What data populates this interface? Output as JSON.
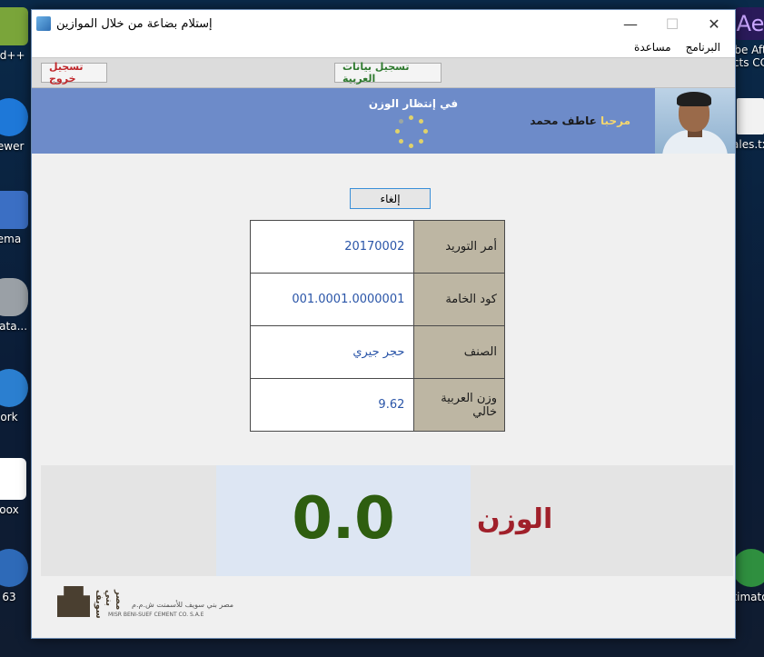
{
  "window": {
    "title": "إستلام بضاعة من خلال الموازين"
  },
  "menu": {
    "items": [
      "البرنامج",
      "مساعدة"
    ]
  },
  "toolbar": {
    "exit_label": "تسجيل خروج",
    "register_label": "تسجيل بيانات العربية"
  },
  "header": {
    "waiting_text": "في إنتظار الوزن",
    "welcome_prefix": "مرحبا",
    "user_name": "عاطف محمد"
  },
  "form": {
    "cancel_label": "إلغاء",
    "rows": [
      {
        "label": "أمر التوريد",
        "value": "20170002"
      },
      {
        "label": "كود الخامة",
        "value": "001.0001.0000001"
      },
      {
        "label": "الصنف",
        "value": "حجر جيري"
      },
      {
        "label": "وزن العربية خالي",
        "value": "9.62"
      }
    ]
  },
  "weight": {
    "value": "0.0",
    "label": "الوزن"
  },
  "footer": {
    "company_ar": "مصر بني سويف للأسمنت   ش.م.م",
    "company_en": "MISR BENI-SUEF CEMENT CO. S.A.E",
    "brand_ar": "مصر بني سويف"
  },
  "desktop": {
    "icons": [
      {
        "label": "ad++",
        "color": "#7aa53a"
      },
      {
        "label": "iewer",
        "color": "#1e78d8"
      },
      {
        "label": "ema",
        "color": "#3b6fc4"
      },
      {
        "label": "Data...",
        "color": "#9aa0a6"
      },
      {
        "label": "ork",
        "color": "#2b7fd0"
      },
      {
        "label": "oox",
        "color": "#0061ff"
      },
      {
        "label": "63",
        "color": "#2e6ab8"
      },
      {
        "label": "be Aft",
        "color": "#2a1a5a"
      },
      {
        "label": "ales.txt",
        "color": "#f2f2f2"
      },
      {
        "label": "timato",
        "color": "#2f8f3f"
      }
    ],
    "ae_text": "Ae",
    "ae_sub": "cts CC"
  },
  "colors": {
    "header_bg": "#6d8bc9",
    "label_bg": "#bdb6a3",
    "value_text": "#2a55a8",
    "weight_value": "#2e5e10",
    "weight_label": "#a0202a"
  }
}
